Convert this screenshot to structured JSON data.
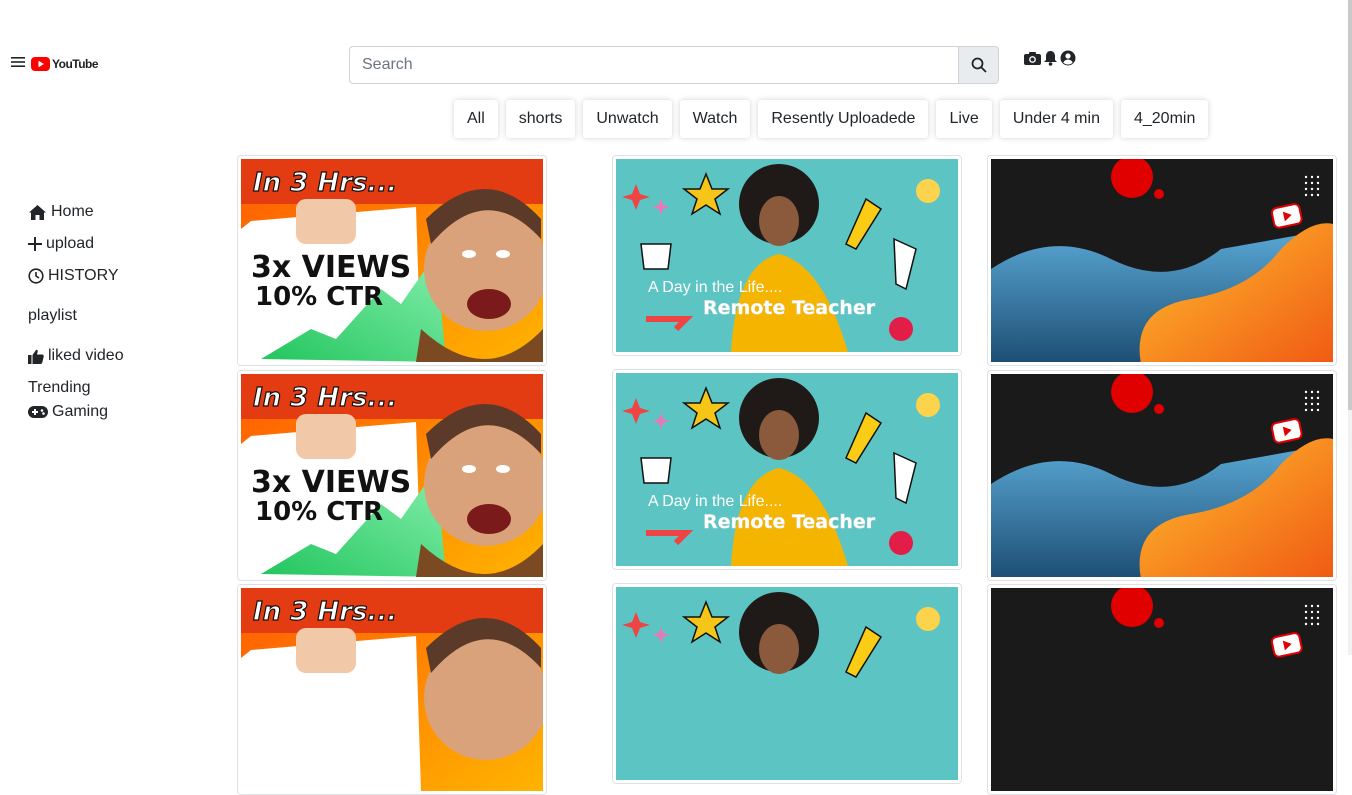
{
  "header": {
    "logo_text": "YouTube",
    "search_placeholder": "Search"
  },
  "chips": [
    "All",
    "shorts",
    "Unwatch",
    "Watch",
    "Resently Uploadede",
    "Live",
    "Under 4 min",
    "4_20min"
  ],
  "sidebar": {
    "home": "Home",
    "upload": "upload",
    "history": "HISTORY",
    "playlist": "playlist",
    "liked": "liked video",
    "trending": "Trending",
    "gaming": "Gaming"
  },
  "thumbnails": {
    "elon": {
      "headline": "In 3 Hrs...",
      "line1": "3x VIEWS",
      "line2": "10% CTR"
    },
    "teacher": {
      "line1": "A Day in the Life....",
      "line2": "Remote Teacher"
    }
  },
  "colors": {
    "brand_red": "#ff0000",
    "chip_shadow": "#d0d0d0"
  }
}
